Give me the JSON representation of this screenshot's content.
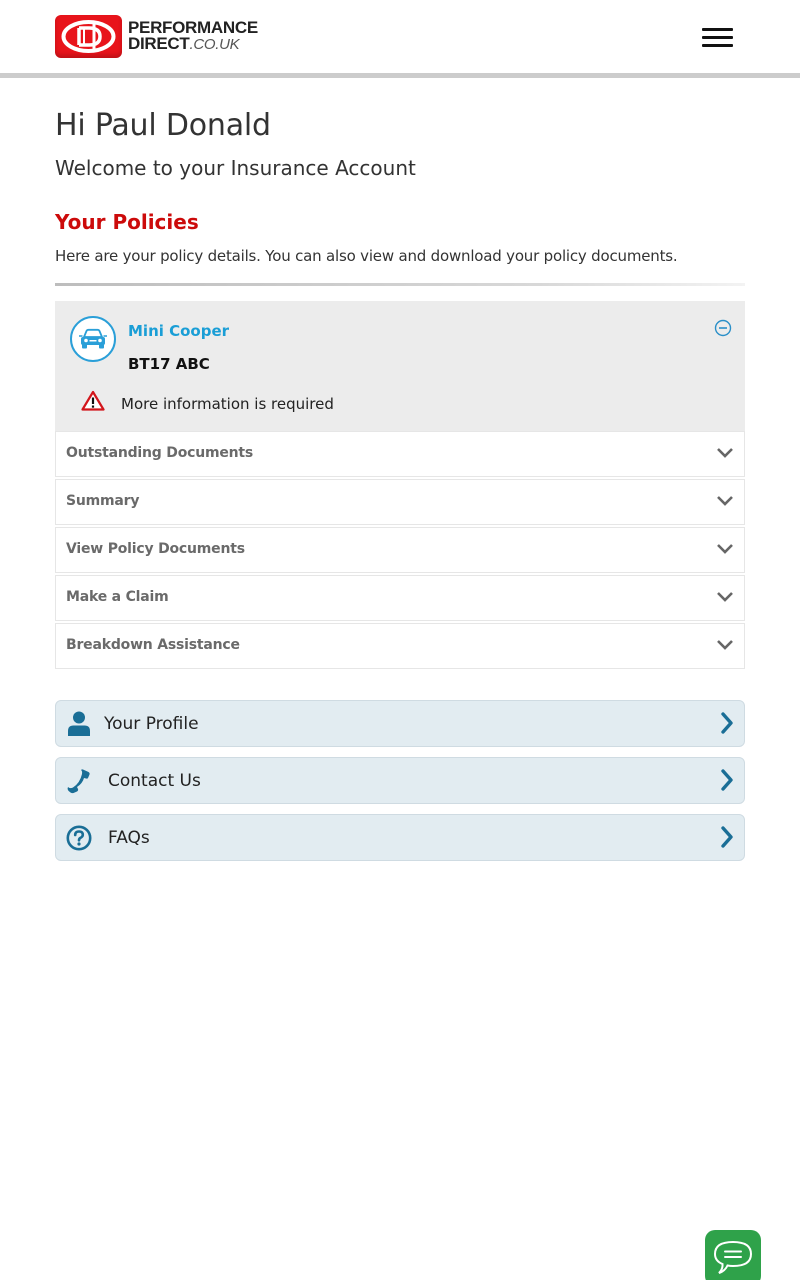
{
  "header": {
    "logo": {
      "line1": "PERFORMANCE",
      "line2_bold": "DIRECT",
      "line2_suffix": ".CO.UK"
    },
    "menu_icon": "hamburger-menu-icon"
  },
  "greeting": {
    "title": "Hi Paul Donald",
    "subtitle": "Welcome to your Insurance Account"
  },
  "policies": {
    "title": "Your Policies",
    "description": "Here are your policy details. You can also view and download your policy documents.",
    "policy": {
      "vehicle": "Mini Cooper",
      "registration": "BT17 ABC",
      "alert": "More information is required",
      "icons": {
        "vehicle": "car-icon",
        "alert": "warning-triangle-icon",
        "toggle": "collapse-minus-icon"
      }
    },
    "sections": [
      {
        "label": "Outstanding Documents"
      },
      {
        "label": "Summary"
      },
      {
        "label": "View Policy Documents"
      },
      {
        "label": "Make a Claim"
      },
      {
        "label": "Breakdown Assistance"
      }
    ]
  },
  "links": [
    {
      "label": "Your Profile",
      "icon": "user-icon"
    },
    {
      "label": "Contact Us",
      "icon": "phone-icon"
    },
    {
      "label": "FAQs",
      "icon": "question-circle-icon"
    }
  ],
  "chat": {
    "icon": "chat-bubble-icon"
  },
  "colors": {
    "brand_red": "#e8141b",
    "heading_red": "#cc0a0a",
    "accent_blue": "#1a9ed6",
    "link_icon_blue": "#1a6e96",
    "link_card_bg": "#e2ecf1",
    "chat_green": "#2fa24a"
  }
}
